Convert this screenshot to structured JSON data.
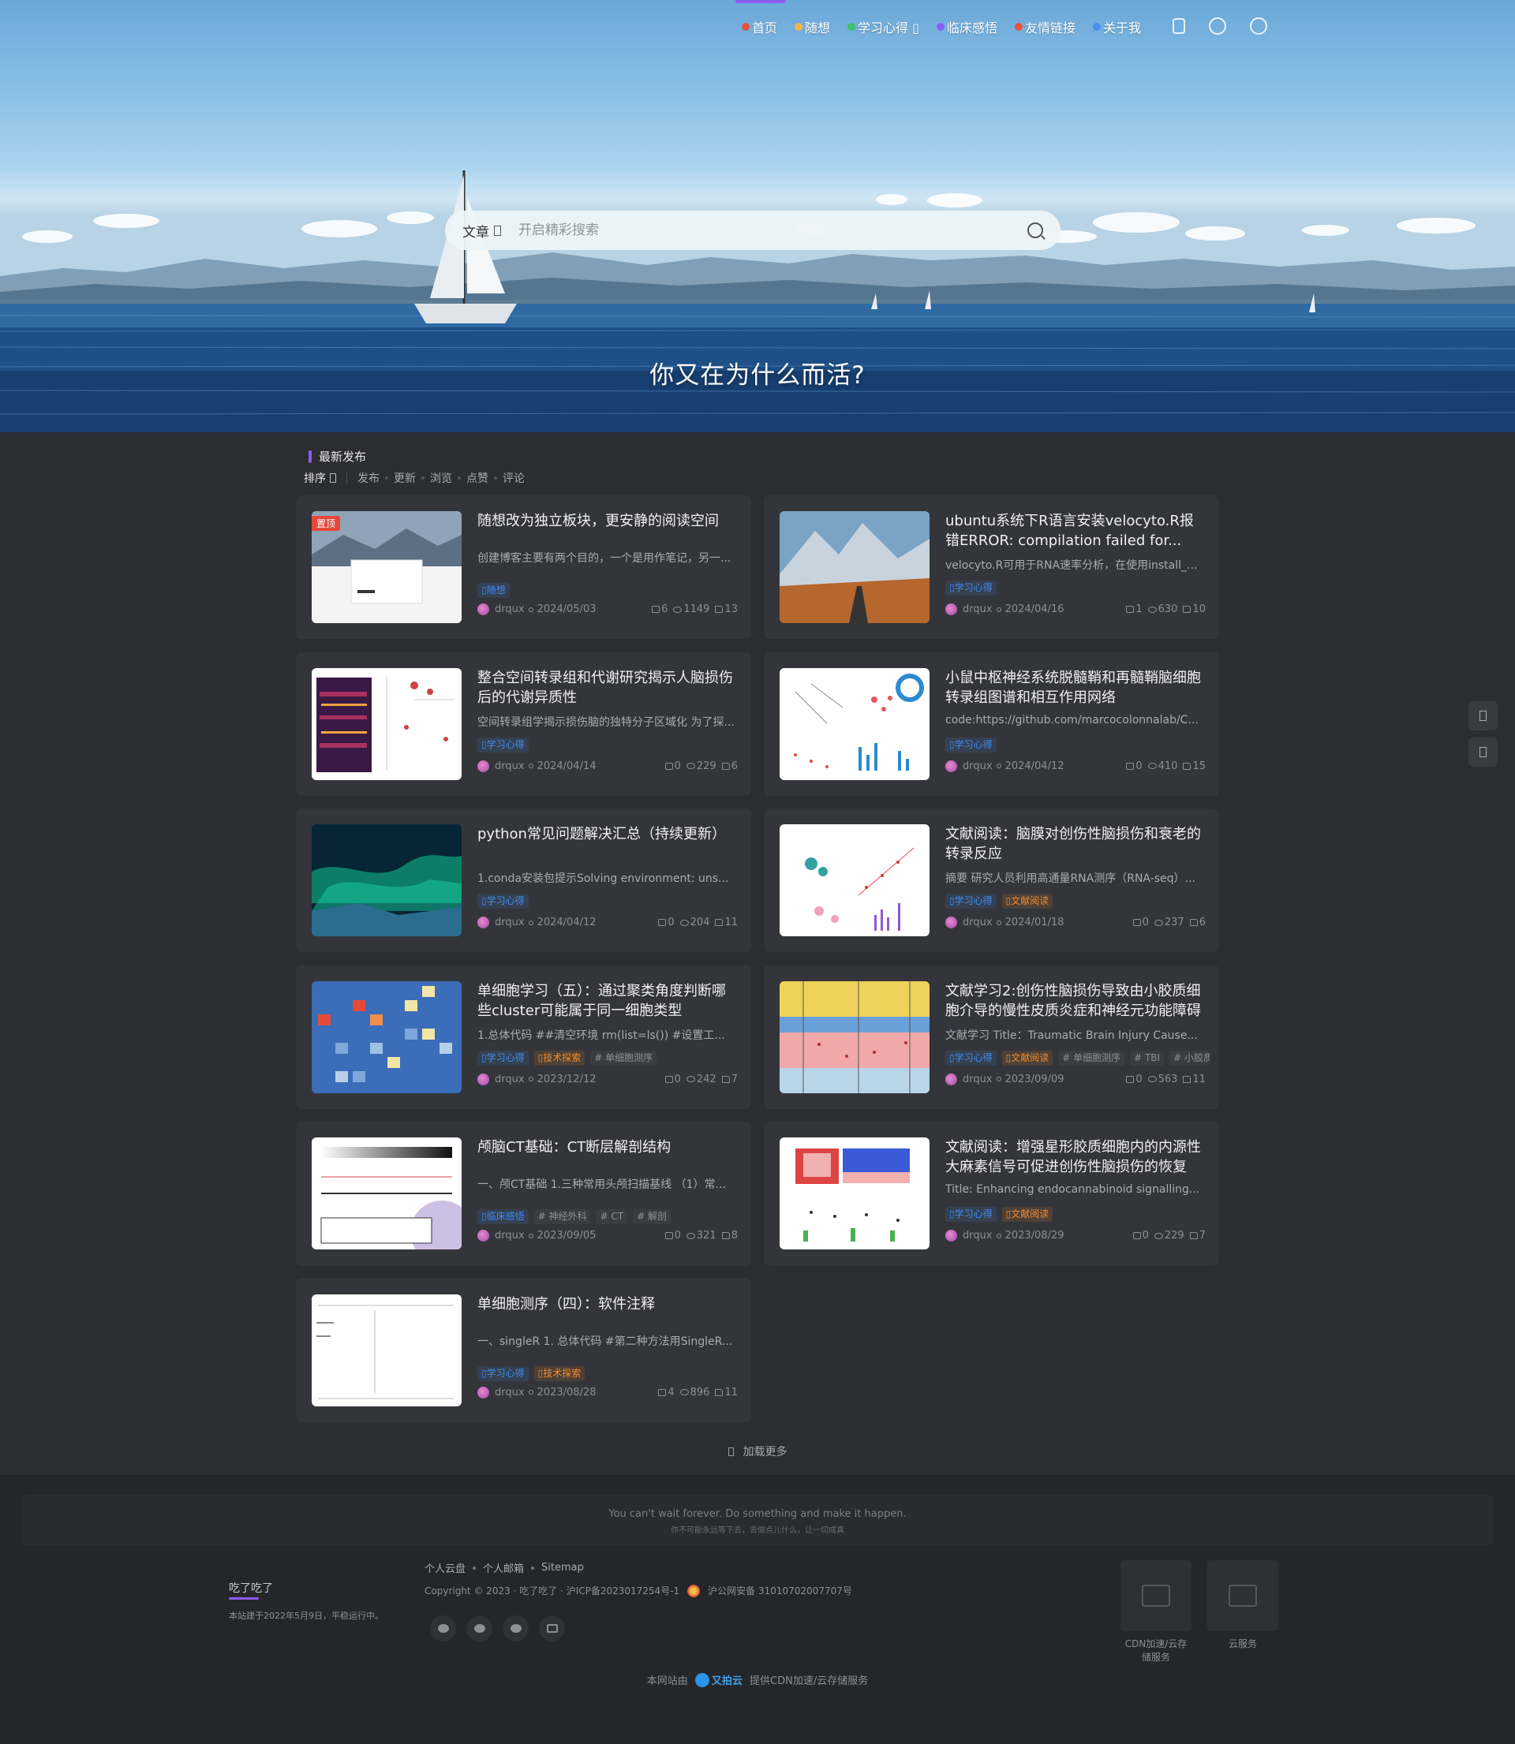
{
  "nav": {
    "items": [
      {
        "label": "首页",
        "color": "#e9523f"
      },
      {
        "label": "随想",
        "color": "#f2b64a"
      },
      {
        "label": "学习心得 ▯",
        "color": "#44c06a"
      },
      {
        "label": "临床感悟",
        "color": "#8a5cf5"
      },
      {
        "label": "友情链接",
        "color": "#e9523f"
      },
      {
        "label": "关于我",
        "color": "#4a8ef0"
      }
    ],
    "tools": [
      "theme-icon",
      "bulb-icon",
      "search-icon"
    ]
  },
  "search": {
    "category": "文章",
    "placeholder": "开启精彩搜索"
  },
  "hero": {
    "motto": "你又在为什么而活?"
  },
  "list": {
    "section_title": "最新发布",
    "sort_label": "排序",
    "sort_options": [
      "发布",
      "更新",
      "浏览",
      "点赞",
      "评论"
    ],
    "posts": [
      {
        "pinned": true,
        "pin_label": "置顶",
        "title": "随想改为独立板块，更安静的阅读空间",
        "excerpt": "创建博客主要有两个目的，一个是用作笔记，另一...",
        "tags": [
          {
            "label": "▯随想",
            "c": "blue"
          }
        ],
        "author": "drqux",
        "date": "2024/05/03",
        "comments": "6",
        "views": "1149",
        "likes": "13",
        "thumb": "website"
      },
      {
        "pinned": false,
        "title": "ubuntu系统下R语言安装velocyto.R报错ERROR: compilation failed for...",
        "excerpt": "velocyto.R可用于RNA速率分析，在使用install_...",
        "tags": [
          {
            "label": "▯学习心得",
            "c": "blue"
          }
        ],
        "author": "drqux",
        "date": "2024/04/16",
        "comments": "1",
        "views": "630",
        "likes": "10",
        "thumb": "mountain"
      },
      {
        "pinned": false,
        "title": "整合空间转录组和代谢研究揭示人脑损伤后的代谢异质性",
        "excerpt": "空间转录组学揭示损伤脑的独特分子区域化 为了探...",
        "tags": [
          {
            "label": "▯学习心得",
            "c": "blue"
          }
        ],
        "author": "drqux",
        "date": "2024/04/14",
        "comments": "0",
        "views": "229",
        "likes": "6",
        "thumb": "heatmap"
      },
      {
        "pinned": false,
        "title": "小鼠中枢神经系统脱髓鞘和再髓鞘脑细胞转录组图谱和相互作用网络",
        "excerpt": "code:https://github.com/marcocolonnalab/C...",
        "tags": [
          {
            "label": "▯学习心得",
            "c": "blue"
          }
        ],
        "author": "drqux",
        "date": "2024/04/12",
        "comments": "0",
        "views": "410",
        "likes": "15",
        "thumb": "figure"
      },
      {
        "pinned": false,
        "title": "python常见问题解决汇总（持续更新）",
        "excerpt": "1.conda安装包提示Solving environment: uns...",
        "tags": [
          {
            "label": "▯学习心得",
            "c": "blue"
          }
        ],
        "author": "drqux",
        "date": "2024/04/12",
        "comments": "0",
        "views": "204",
        "likes": "11",
        "thumb": "aurora"
      },
      {
        "pinned": false,
        "title": "文献阅读：脑膜对创伤性脑损伤和衰老的转录反应",
        "excerpt": "摘要 研究人员利用高通量RNA测序（RNA-seq）...",
        "tags": [
          {
            "label": "▯学习心得",
            "c": "blue"
          },
          {
            "label": "▯文献阅读",
            "c": "orange"
          }
        ],
        "author": "drqux",
        "date": "2024/01/18",
        "comments": "0",
        "views": "237",
        "likes": "6",
        "thumb": "figure2"
      },
      {
        "pinned": false,
        "title": "单细胞学习（五）：通过聚类角度判断哪些cluster可能属于同一细胞类型",
        "excerpt": "1.总体代码 ##清空环境 rm(list=ls()) #设置工...",
        "tags": [
          {
            "label": "▯学习心得",
            "c": "blue"
          },
          {
            "label": "▯技术探索",
            "c": "orange"
          },
          {
            "label": "# 单细胞测序",
            "c": "gray"
          }
        ],
        "author": "drqux",
        "date": "2023/12/12",
        "comments": "0",
        "views": "242",
        "likes": "7",
        "thumb": "grid"
      },
      {
        "pinned": false,
        "title": "文献学习2:创伤性脑损伤导致由小胶质细胞介导的慢性皮质炎症和神经元功能障碍",
        "excerpt": "文献学习 Title：Traumatic Brain Injury Cause...",
        "tags": [
          {
            "label": "▯学习心得",
            "c": "blue"
          },
          {
            "label": "▯文献阅读",
            "c": "orange"
          },
          {
            "label": "# 单细胞测序",
            "c": "gray"
          },
          {
            "label": "# TBI",
            "c": "gray"
          },
          {
            "label": "# 小胶质",
            "c": "gray"
          }
        ],
        "author": "drqux",
        "date": "2023/09/09",
        "comments": "0",
        "views": "563",
        "likes": "11",
        "thumb": "layers"
      },
      {
        "pinned": false,
        "title": "颅脑CT基础：CT断层解剖结构",
        "excerpt": "一、颅CT基础 1.三种常用头颅扫描基线 （1）常...",
        "tags": [
          {
            "label": "▯临床感悟",
            "c": "blue"
          },
          {
            "label": "# 神经外科",
            "c": "gray"
          },
          {
            "label": "# CT",
            "c": "gray"
          },
          {
            "label": "# 解剖",
            "c": "gray"
          }
        ],
        "author": "drqux",
        "date": "2023/09/05",
        "comments": "0",
        "views": "321",
        "likes": "8",
        "thumb": "ct"
      },
      {
        "pinned": false,
        "title": "文献阅读：增强星形胶质细胞内的内源性大麻素信号可促进创伤性脑损伤的恢复",
        "excerpt": "Title: Enhancing endocannabinoid signalling...",
        "tags": [
          {
            "label": "▯学习心得",
            "c": "blue"
          },
          {
            "label": "▯文献阅读",
            "c": "orange"
          }
        ],
        "author": "drqux",
        "date": "2023/08/29",
        "comments": "0",
        "views": "229",
        "likes": "7",
        "thumb": "redblue"
      },
      {
        "pinned": false,
        "title": "单细胞测序（四）：软件注释",
        "excerpt": "一、singleR 1. 总体代码 #第二种方法用SingleR...",
        "tags": [
          {
            "label": "▯学习心得",
            "c": "blue"
          },
          {
            "label": "▯技术探索",
            "c": "orange"
          }
        ],
        "author": "drqux",
        "date": "2023/08/28",
        "comments": "4",
        "views": "896",
        "likes": "11",
        "thumb": "doc"
      }
    ],
    "load_more": "加载更多"
  },
  "footer": {
    "quote_en": "You can't wait forever. Do something and make it happen.",
    "quote_zh": "你不可能永远等下去，去做点儿什么，让一切成真",
    "brand": "吃了吃了",
    "brand_desc": "本站建于2022年5月9日，平稳运行中。",
    "links": [
      "个人云盘",
      "个人邮箱",
      "Sitemap"
    ],
    "copyright": "Copyright © 2023 · 吃了吃了 · 沪ICP备2023017254号-1",
    "police": "沪公网安备 31010702007707号",
    "socials": [
      "wechat-icon",
      "qq-icon",
      "weibo-icon",
      "mail-icon"
    ],
    "qr": [
      {
        "caption": "CDN加速/云存储服务"
      },
      {
        "caption": "云服务"
      }
    ],
    "host_prefix": "本网站由",
    "host_brand": "又拍云",
    "host_suffix": "提供CDN加速/云存储服务"
  }
}
